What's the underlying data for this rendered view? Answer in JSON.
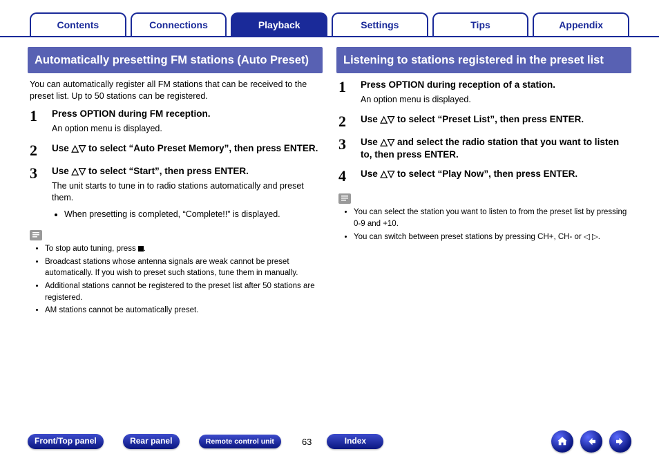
{
  "tabs": {
    "items": [
      "Contents",
      "Connections",
      "Playback",
      "Settings",
      "Tips",
      "Appendix"
    ],
    "active_index": 2
  },
  "left": {
    "header": "Automatically presetting FM stations (Auto Preset)",
    "intro": "You can automatically register all FM stations that can be received to the preset list. Up to 50 stations can be registered.",
    "steps": [
      {
        "num": "1",
        "title": "Press OPTION during FM reception.",
        "desc": "An option menu is displayed."
      },
      {
        "num": "2",
        "title": "Use △▽ to select “Auto Preset Memory”, then press ENTER."
      },
      {
        "num": "3",
        "title": "Use △▽ to select “Start”, then press ENTER.",
        "desc": "The unit starts to tune in to radio stations automatically and preset them.",
        "bullets": [
          "When presetting is completed, “Complete!!” is displayed."
        ]
      }
    ],
    "notes": [
      "To stop auto tuning, press ■.",
      "Broadcast stations whose antenna signals are weak cannot be preset automatically. If you wish to preset such stations, tune them in manually.",
      "Additional stations cannot be registered to the preset list after 50 stations are registered.",
      "AM stations cannot be automatically preset."
    ]
  },
  "right": {
    "header": "Listening to stations registered in the preset list",
    "steps": [
      {
        "num": "1",
        "title": "Press OPTION during reception of a station.",
        "desc": "An option menu is displayed."
      },
      {
        "num": "2",
        "title": "Use △▽ to select “Preset List”, then press ENTER."
      },
      {
        "num": "3",
        "title": "Use △▽ and select the radio station that you want to listen to, then press ENTER."
      },
      {
        "num": "4",
        "title": "Use △▽ to select “Play Now”, then press ENTER."
      }
    ],
    "notes": [
      "You can select the station you want to listen to from the preset list by pressing 0-9 and +10.",
      "You can switch between preset stations by pressing CH+, CH- or ◁ ▷."
    ]
  },
  "footer": {
    "buttons": [
      "Front/Top panel",
      "Rear panel",
      "Remote control unit"
    ],
    "page": "63",
    "index": "Index"
  }
}
